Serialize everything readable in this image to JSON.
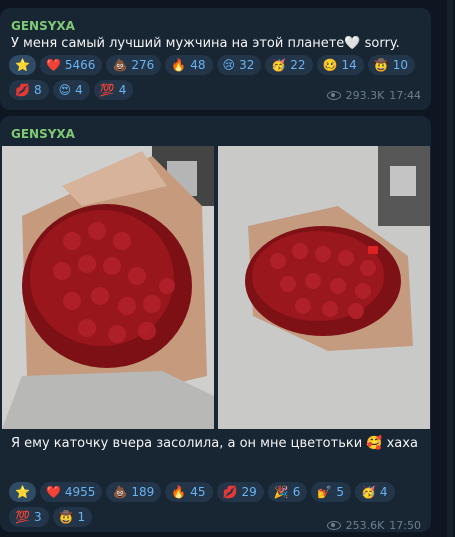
{
  "messages": [
    {
      "author": "GENSYXA",
      "text": "У меня самый лучший мужчина на этой планете🤍 sorry.",
      "reactions_row1": [
        {
          "emoji": "⭐",
          "count": ""
        },
        {
          "emoji": "❤️",
          "count": "5466"
        },
        {
          "emoji": "💩",
          "count": "276"
        },
        {
          "emoji": "🔥",
          "count": "48"
        },
        {
          "emoji": "😢",
          "count": "32"
        },
        {
          "emoji": "🥳",
          "count": "22"
        },
        {
          "emoji": "🥴",
          "count": "14"
        },
        {
          "emoji": "🤠",
          "count": "10"
        }
      ],
      "reactions_row2": [
        {
          "emoji": "💋",
          "count": "8"
        },
        {
          "emoji": "😍",
          "count": "4"
        },
        {
          "emoji": "💯",
          "count": "4"
        }
      ],
      "views": "293.3K",
      "time": "17:44"
    },
    {
      "author": "GENSYXA",
      "text": "Я ему каточку вчера засолила, а он мне цветотьки 🥰 хаха",
      "photos": [
        "photo-bouquet-1",
        "photo-bouquet-2"
      ],
      "reactions_row1": [
        {
          "emoji": "⭐",
          "count": ""
        },
        {
          "emoji": "❤️",
          "count": "4955"
        },
        {
          "emoji": "💩",
          "count": "189"
        },
        {
          "emoji": "🔥",
          "count": "45"
        },
        {
          "emoji": "💋",
          "count": "29"
        },
        {
          "emoji": "🎉",
          "count": "6"
        },
        {
          "emoji": "💅",
          "count": "5"
        },
        {
          "emoji": "🥳",
          "count": "4"
        }
      ],
      "reactions_row2": [
        {
          "emoji": "💯",
          "count": "3"
        },
        {
          "emoji": "🤠",
          "count": "1"
        }
      ],
      "views": "253.6K",
      "time": "17:50"
    }
  ],
  "colors": {
    "background": "#0e1621",
    "bubble": "#182533",
    "author": "#7fcb75",
    "reaction_bg": "#233548",
    "reaction_text": "#6ab3f3",
    "meta": "#6d7f8f"
  }
}
